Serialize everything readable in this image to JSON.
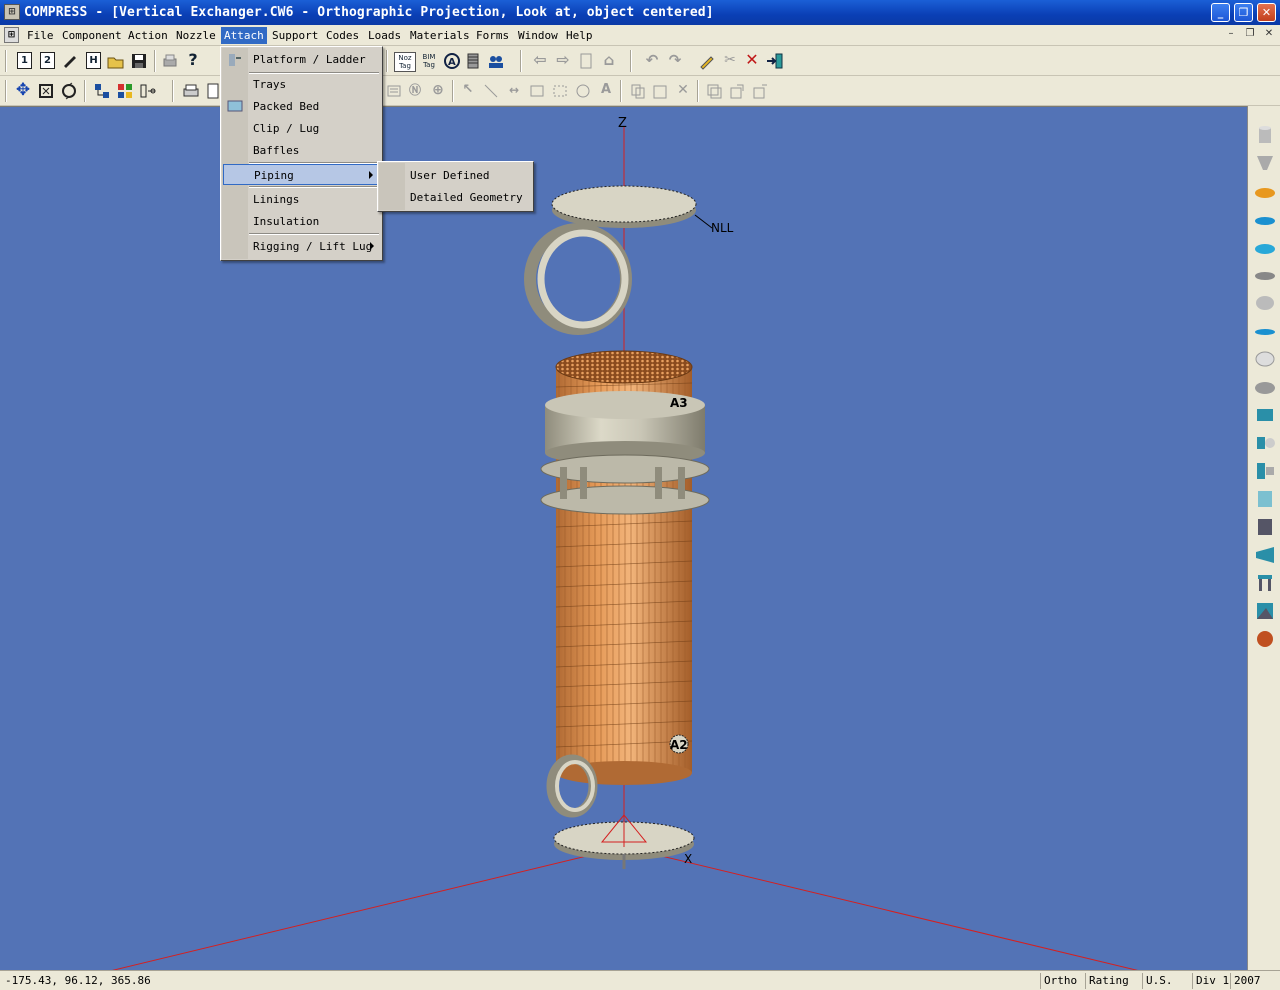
{
  "window": {
    "title": "COMPRESS - [Vertical Exchanger.CW6 - Orthographic Projection, Look at, object centered]",
    "app_icon": "compress-app-icon",
    "controls": [
      "_",
      "❐",
      "✕"
    ]
  },
  "menubar": {
    "items": [
      "File",
      "Component",
      "Action",
      "Nozzle",
      "Attach",
      "Support",
      "Codes",
      "Loads",
      "Materials",
      "Forms",
      "Window",
      "Help"
    ],
    "active": "Attach"
  },
  "toolbar1": {
    "buttons": [
      "1",
      "2",
      "pencil",
      "H",
      "open",
      "save",
      "print",
      "?",
      "undo",
      "redo",
      "edit",
      "cut",
      "delete",
      "export"
    ],
    "nozzle_tag": "Noz Tag",
    "bim_tag": "BIM Tag"
  },
  "attach_menu": {
    "items": [
      {
        "label": "Platform / Ladder",
        "icon": "platform-ladder-icon"
      },
      {
        "label": "Trays"
      },
      {
        "label": "Packed Bed",
        "icon": "packed-bed-icon"
      },
      {
        "label": "Clip / Lug"
      },
      {
        "label": "Baffles"
      },
      {
        "label": "Piping",
        "submenu": true,
        "highlighted": true
      },
      {
        "label": "Linings"
      },
      {
        "label": "Insulation"
      },
      {
        "label": "Rigging / Lift Lug",
        "submenu": true
      }
    ]
  },
  "piping_submenu": {
    "items": [
      "User Defined",
      "Detailed Geometry"
    ]
  },
  "viewport": {
    "axis_z": "Z",
    "axis_x": "X",
    "labels": {
      "nll": "NLL",
      "nozzle_a3": "A3",
      "nozzle_a2": "A2"
    },
    "colors": {
      "background": "#5373b6",
      "shell": "#d8874a",
      "metal": "#c9c6b6",
      "axis": "#d42020"
    }
  },
  "palette": {
    "items": [
      "cylinder-icon",
      "cone-icon",
      "ellipsoidal-head-icon",
      "hemi-head-icon",
      "torispherical-head-icon",
      "flat-head-icon",
      "flange-head-icon",
      "blue-disk-icon",
      "skirt-icon",
      "reducer-icon",
      "flange-pair-icon",
      "body-flange-icon",
      "tubesheet-icon",
      "expansion-joint-icon",
      "shell-cylinder-icon",
      "cone-transition-icon",
      "leg-support-icon",
      "saddle-icon",
      "lug-icon"
    ]
  },
  "statusbar": {
    "coords": "-175.43, 96.12, 365.86",
    "mode": "Ortho",
    "rating": "Rating",
    "units": "U.S.",
    "division": "Div 1",
    "year": "2007"
  }
}
